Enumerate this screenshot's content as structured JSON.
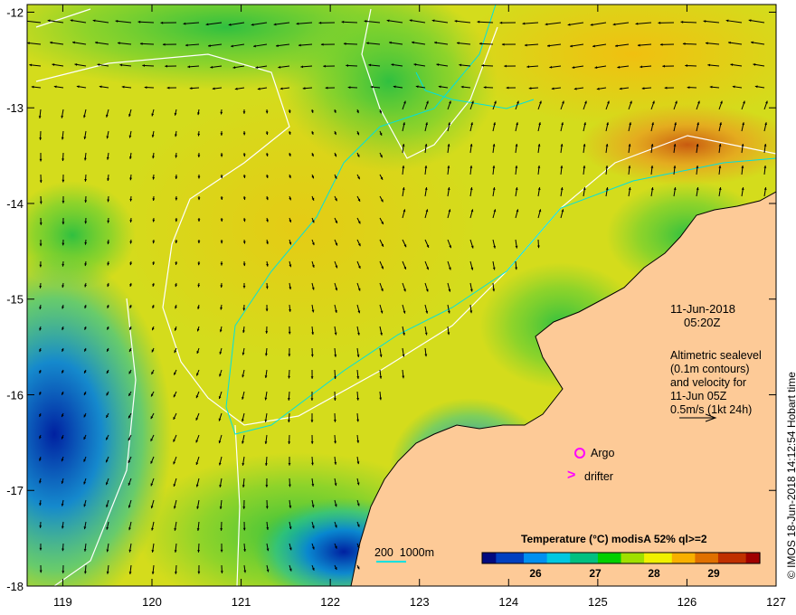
{
  "map": {
    "x_ticks": [
      "119",
      "120",
      "121",
      "122",
      "123",
      "124",
      "125",
      "126",
      "127"
    ],
    "y_ticks": [
      "-12",
      "-13",
      "-14",
      "-15",
      "-16",
      "-17",
      "-18"
    ],
    "lon_range": [
      118.6,
      127
    ],
    "lat_range": [
      -11.92,
      -18
    ],
    "colors": {
      "land": "#fdca97",
      "arrow": "#000000",
      "sealevel_contour": "#ffffff",
      "bathymetry_contour": "#00e0e0",
      "marker": "#ff00ff"
    }
  },
  "annotation": {
    "date": "11-Jun-2018",
    "time": "05:20Z",
    "desc_lines": [
      "Altimetric sealevel",
      "(0.1m contours)",
      "and velocity for",
      "11-Jun 05Z",
      "0.5m/s (1kt 24h)"
    ]
  },
  "legend": {
    "argo": "Argo",
    "drifter_symbol": ">",
    "drifter": "drifter",
    "bathy_label": "200  1000m"
  },
  "colorbar": {
    "title": "Temperature (°C) modisA 52% ql>=2",
    "ticks": [
      "26",
      "27",
      "28",
      "29"
    ],
    "range": [
      25.1,
      29.75
    ],
    "colors": [
      "#000a80",
      "#0040c0",
      "#0090f0",
      "#00c8e0",
      "#00c080",
      "#00d000",
      "#a0e000",
      "#f0f000",
      "#f8b000",
      "#e07000",
      "#c03000",
      "#a00000"
    ]
  },
  "credit": "© IMOS 18-Jun-2018 14:12:54 Hobart time"
}
